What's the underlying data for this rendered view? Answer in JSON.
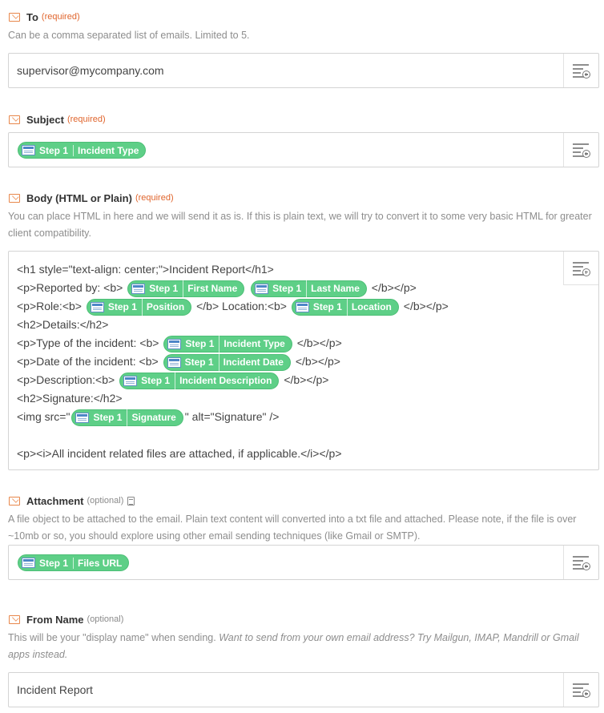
{
  "to": {
    "label": "To",
    "req": "(required)",
    "help": "Can be a comma separated list of emails. Limited to 5.",
    "value": "supervisor@mycompany.com"
  },
  "subject": {
    "label": "Subject",
    "req": "(required)",
    "pill": {
      "step": "Step 1",
      "name": "Incident Type"
    }
  },
  "body": {
    "label": "Body (HTML or Plain)",
    "req": "(required)",
    "help": "You can place HTML in here and we will send it as is. If this is plain text, we will try to convert it to some very basic HTML for greater client compatibility.",
    "lines": {
      "l1": "<h1 style=\"text-align: center;\">Incident Report</h1>",
      "l2a": "<p>Reported by: <b>",
      "l2p1": {
        "step": "Step 1",
        "name": "First Name"
      },
      "l2p2": {
        "step": "Step 1",
        "name": "Last Name"
      },
      "l2b": "</b></p>",
      "l3a": "<p>Role:<b>",
      "l3p1": {
        "step": "Step 1",
        "name": "Position"
      },
      "l3b": "</b> Location:<b>",
      "l3p2": {
        "step": "Step 1",
        "name": "Location"
      },
      "l3c": "</b></p>",
      "l4": "<h2>Details:</h2>",
      "l5a": "<p>Type of the incident: <b>",
      "l5p": {
        "step": "Step 1",
        "name": "Incident Type"
      },
      "l5b": "</b></p>",
      "l6a": "<p>Date of the incident: <b>",
      "l6p": {
        "step": "Step 1",
        "name": "Incident Date"
      },
      "l6b": "</b></p>",
      "l7a": "<p>Description:<b>",
      "l7p": {
        "step": "Step 1",
        "name": "Incident Description"
      },
      "l7b": "</b></p>",
      "l8": "<h2>Signature:</h2>",
      "l9a": "<img src=\"",
      "l9p": {
        "step": "Step 1",
        "name": "Signature"
      },
      "l9b": "\" alt=\"Signature\" />",
      "l11": "<p><i>All incident related files are attached, if applicable.</i></p>"
    }
  },
  "attachment": {
    "label": "Attachment",
    "opt": "(optional)",
    "help": "A file object to be attached to the email. Plain text content will converted into a txt file and attached. Please note, if the file is over ~10mb or so, you should explore using other email sending techniques (like Gmail or SMTP).",
    "pill": {
      "step": "Step 1",
      "name": "Files URL"
    }
  },
  "from_name": {
    "label": "From Name",
    "opt": "(optional)",
    "help_plain": "This will be your \"display name\" when sending.",
    "help_em": "Want to send from your own email address? Try Mailgun, IMAP, Mandrill or Gmail apps instead.",
    "value": "Incident Report"
  },
  "colors": {
    "accent": "#e8874b",
    "pill": "#5ecf87",
    "required": "#e0652d"
  },
  "icons": [
    "mail-icon",
    "insert-field-icon",
    "app-icon",
    "note-icon"
  ]
}
